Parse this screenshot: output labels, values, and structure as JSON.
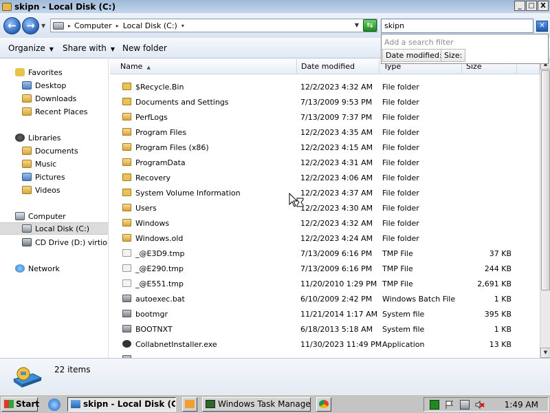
{
  "window": {
    "title": "skipn - Local Disk (C:)"
  },
  "window_buttons": {
    "minimize": "_",
    "maximize": "□",
    "close": "X"
  },
  "address": {
    "crumbs": [
      "Computer",
      "Local Disk (C:)"
    ]
  },
  "search": {
    "value": "skipn",
    "hint": "Add a search filter",
    "filters": [
      "Date modified:",
      "Size:"
    ]
  },
  "toolbar": {
    "organize": "Organize",
    "share": "Share with",
    "new_folder": "New folder"
  },
  "nav": {
    "favorites": "Favorites",
    "favorites_items": [
      "Desktop",
      "Downloads",
      "Recent Places"
    ],
    "libraries": "Libraries",
    "libraries_items": [
      "Documents",
      "Music",
      "Pictures",
      "Videos"
    ],
    "computer": "Computer",
    "computer_items": [
      "Local Disk (C:)",
      "CD Drive (D:) virtio-win"
    ],
    "network": "Network"
  },
  "columns": {
    "name": "Name",
    "date": "Date modified",
    "type": "Type",
    "size": "Size"
  },
  "files": [
    {
      "name": "$Recycle.Bin",
      "date": "12/2/2023 4:32 AM",
      "type": "File folder",
      "size": "",
      "icon": "locked-folder-icon"
    },
    {
      "name": "Documents and Settings",
      "date": "7/13/2009 9:53 PM",
      "type": "File folder",
      "size": "",
      "icon": "locked-folder-icon"
    },
    {
      "name": "PerfLogs",
      "date": "7/13/2009 7:37 PM",
      "type": "File folder",
      "size": "",
      "icon": "folder-icon"
    },
    {
      "name": "Program Files",
      "date": "12/2/2023 4:35 AM",
      "type": "File folder",
      "size": "",
      "icon": "folder-icon"
    },
    {
      "name": "Program Files (x86)",
      "date": "12/2/2023 4:15 AM",
      "type": "File folder",
      "size": "",
      "icon": "folder-icon"
    },
    {
      "name": "ProgramData",
      "date": "12/2/2023 4:31 AM",
      "type": "File folder",
      "size": "",
      "icon": "folder-icon"
    },
    {
      "name": "Recovery",
      "date": "12/2/2023 4:06 AM",
      "type": "File folder",
      "size": "",
      "icon": "locked-folder-icon"
    },
    {
      "name": "System Volume Information",
      "date": "12/2/2023 4:37 AM",
      "type": "File folder",
      "size": "",
      "icon": "locked-folder-icon"
    },
    {
      "name": "Users",
      "date": "12/2/2023 4:30 AM",
      "type": "File folder",
      "size": "",
      "icon": "folder-icon"
    },
    {
      "name": "Windows",
      "date": "12/2/2023 4:32 AM",
      "type": "File folder",
      "size": "",
      "icon": "folder-icon"
    },
    {
      "name": "Windows.old",
      "date": "12/2/2023 4:24 AM",
      "type": "File folder",
      "size": "",
      "icon": "folder-icon"
    },
    {
      "name": "_@E3D9.tmp",
      "date": "7/13/2009 6:16 PM",
      "type": "TMP File",
      "size": "37 KB",
      "icon": "file-icon"
    },
    {
      "name": "_@E290.tmp",
      "date": "7/13/2009 6:16 PM",
      "type": "TMP File",
      "size": "244 KB",
      "icon": "file-icon"
    },
    {
      "name": "_@E551.tmp",
      "date": "11/20/2010 1:29 PM",
      "type": "TMP File",
      "size": "2,691 KB",
      "icon": "file-icon"
    },
    {
      "name": "autoexec.bat",
      "date": "6/10/2009 2:42 PM",
      "type": "Windows Batch File",
      "size": "1 KB",
      "icon": "batch-file-icon"
    },
    {
      "name": "bootmgr",
      "date": "11/21/2014 1:17 AM",
      "type": "System file",
      "size": "395 KB",
      "icon": "system-file-icon"
    },
    {
      "name": "BOOTNXT",
      "date": "6/18/2013 5:18 AM",
      "type": "System file",
      "size": "1 KB",
      "icon": "system-file-icon"
    },
    {
      "name": "CollabnetInstaller.exe",
      "date": "11/30/2023 11:49 PM",
      "type": "Application",
      "size": "13 KB",
      "icon": "app-icon"
    }
  ],
  "status": {
    "count": "22 items"
  },
  "taskbar": {
    "start": "Start",
    "tasks": [
      "skipn - Local Disk (C:)",
      "Windows Task Manager"
    ],
    "clock": "1:49 AM"
  }
}
